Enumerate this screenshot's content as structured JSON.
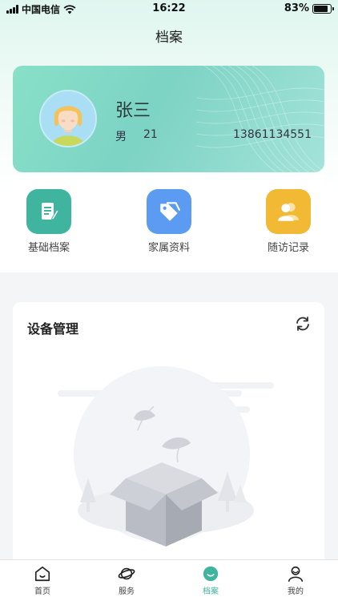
{
  "status_bar": {
    "carrier": "中国电信",
    "time": "16:22",
    "battery": "83%",
    "battery_level": 0.83
  },
  "header": {
    "title": "档案"
  },
  "profile": {
    "name": "张三",
    "gender": "男",
    "age": "21",
    "phone": "13861134551"
  },
  "quick_actions": [
    {
      "label": "基础档案",
      "icon": "document-edit-icon",
      "color": "#3fb59f"
    },
    {
      "label": "家属资料",
      "icon": "tag-icon",
      "color": "#5b9cf2"
    },
    {
      "label": "随访记录",
      "icon": "user-group-icon",
      "color": "#f2b934"
    }
  ],
  "device_section": {
    "title": "设备管理",
    "icon": "refresh-icon"
  },
  "tabbar": {
    "items": [
      {
        "label": "首页",
        "icon": "home-icon"
      },
      {
        "label": "服务",
        "icon": "planet-icon"
      },
      {
        "label": "档案",
        "icon": "archive-icon",
        "active": true
      },
      {
        "label": "我的",
        "icon": "user-icon"
      }
    ],
    "active_color": "#3fb59f"
  }
}
